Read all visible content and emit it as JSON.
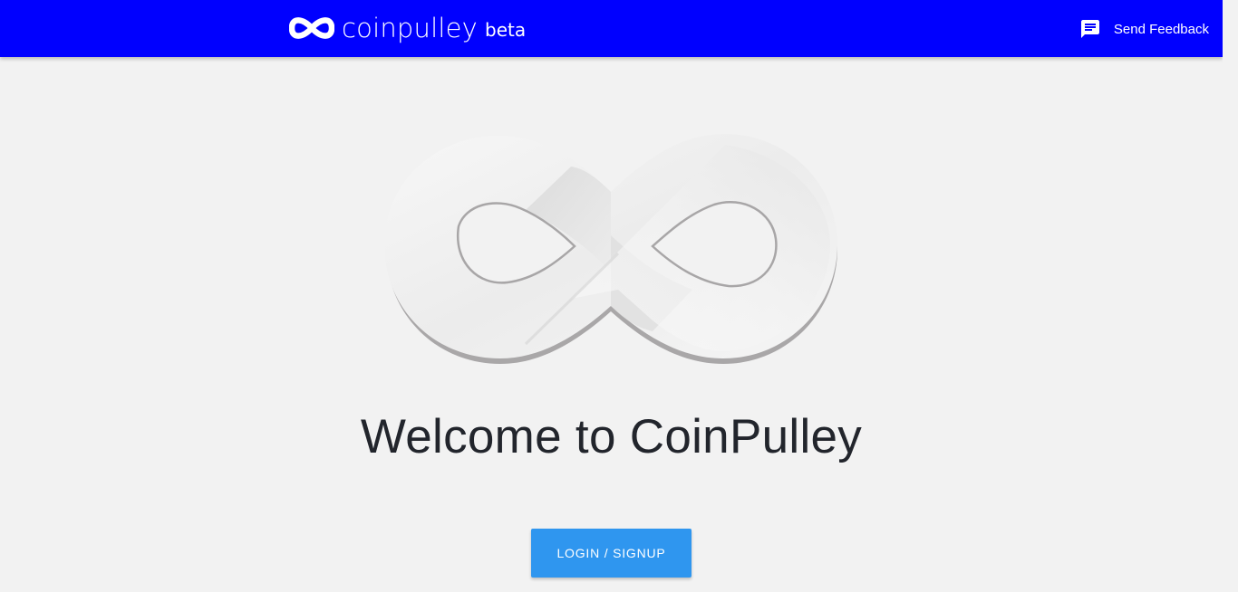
{
  "header": {
    "brand_name": "coinpulley",
    "brand_badge": "beta",
    "brand_icon": "infinity-logo-icon",
    "feedback_icon": "feedback-chat-icon",
    "feedback_label": "Send Feedback",
    "bar_color": "#0000ff"
  },
  "hero": {
    "logo_icon": "infinity-logo-icon",
    "welcome_text": "Welcome to CoinPulley",
    "login_button_label": "LOGIN / SIGNUP",
    "button_color": "#2f96ef"
  }
}
